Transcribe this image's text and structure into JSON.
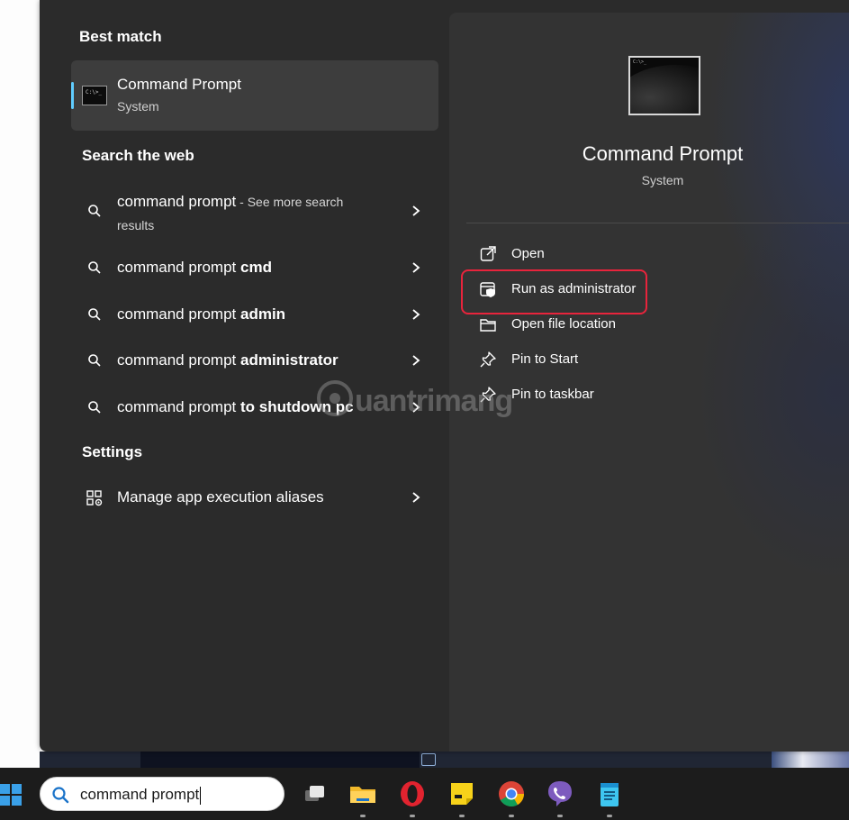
{
  "left_pane": {
    "best_match_heading": "Best match",
    "best_match": {
      "name": "Command Prompt",
      "type": "System"
    },
    "web_heading": "Search the web",
    "web_results": [
      {
        "prefix": "command prompt",
        "suffix": " - See more search results",
        "bold": ""
      },
      {
        "prefix": "command prompt ",
        "bold": "cmd",
        "suffix": ""
      },
      {
        "prefix": "command prompt ",
        "bold": "admin",
        "suffix": ""
      },
      {
        "prefix": "command prompt ",
        "bold": "administrator",
        "suffix": ""
      },
      {
        "prefix": "command prompt ",
        "bold": "to shutdown pc",
        "suffix": ""
      }
    ],
    "settings_heading": "Settings",
    "settings_item": "Manage app execution aliases"
  },
  "right_pane": {
    "app_name": "Command Prompt",
    "app_type": "System",
    "actions": [
      {
        "label": "Open",
        "icon": "open-external-icon"
      },
      {
        "label": "Run as administrator",
        "icon": "shield-admin-icon"
      },
      {
        "label": "Open file location",
        "icon": "folder-icon"
      },
      {
        "label": "Pin to Start",
        "icon": "pin-icon"
      },
      {
        "label": "Pin to taskbar",
        "icon": "pin-icon"
      }
    ],
    "highlighted_action": "Run as administrator",
    "highlight_color": "#e8243c"
  },
  "watermark": "uantrimang",
  "taskbar": {
    "search_value": "command prompt",
    "apps": [
      "task-view-icon",
      "file-explorer-icon",
      "opera-icon",
      "sticky-notes-icon",
      "chrome-icon",
      "viber-icon",
      "notepad-icon"
    ]
  },
  "colors": {
    "accent": "#60cdff",
    "panel": "#2b2b2b",
    "selection": "#3d3d3d"
  }
}
